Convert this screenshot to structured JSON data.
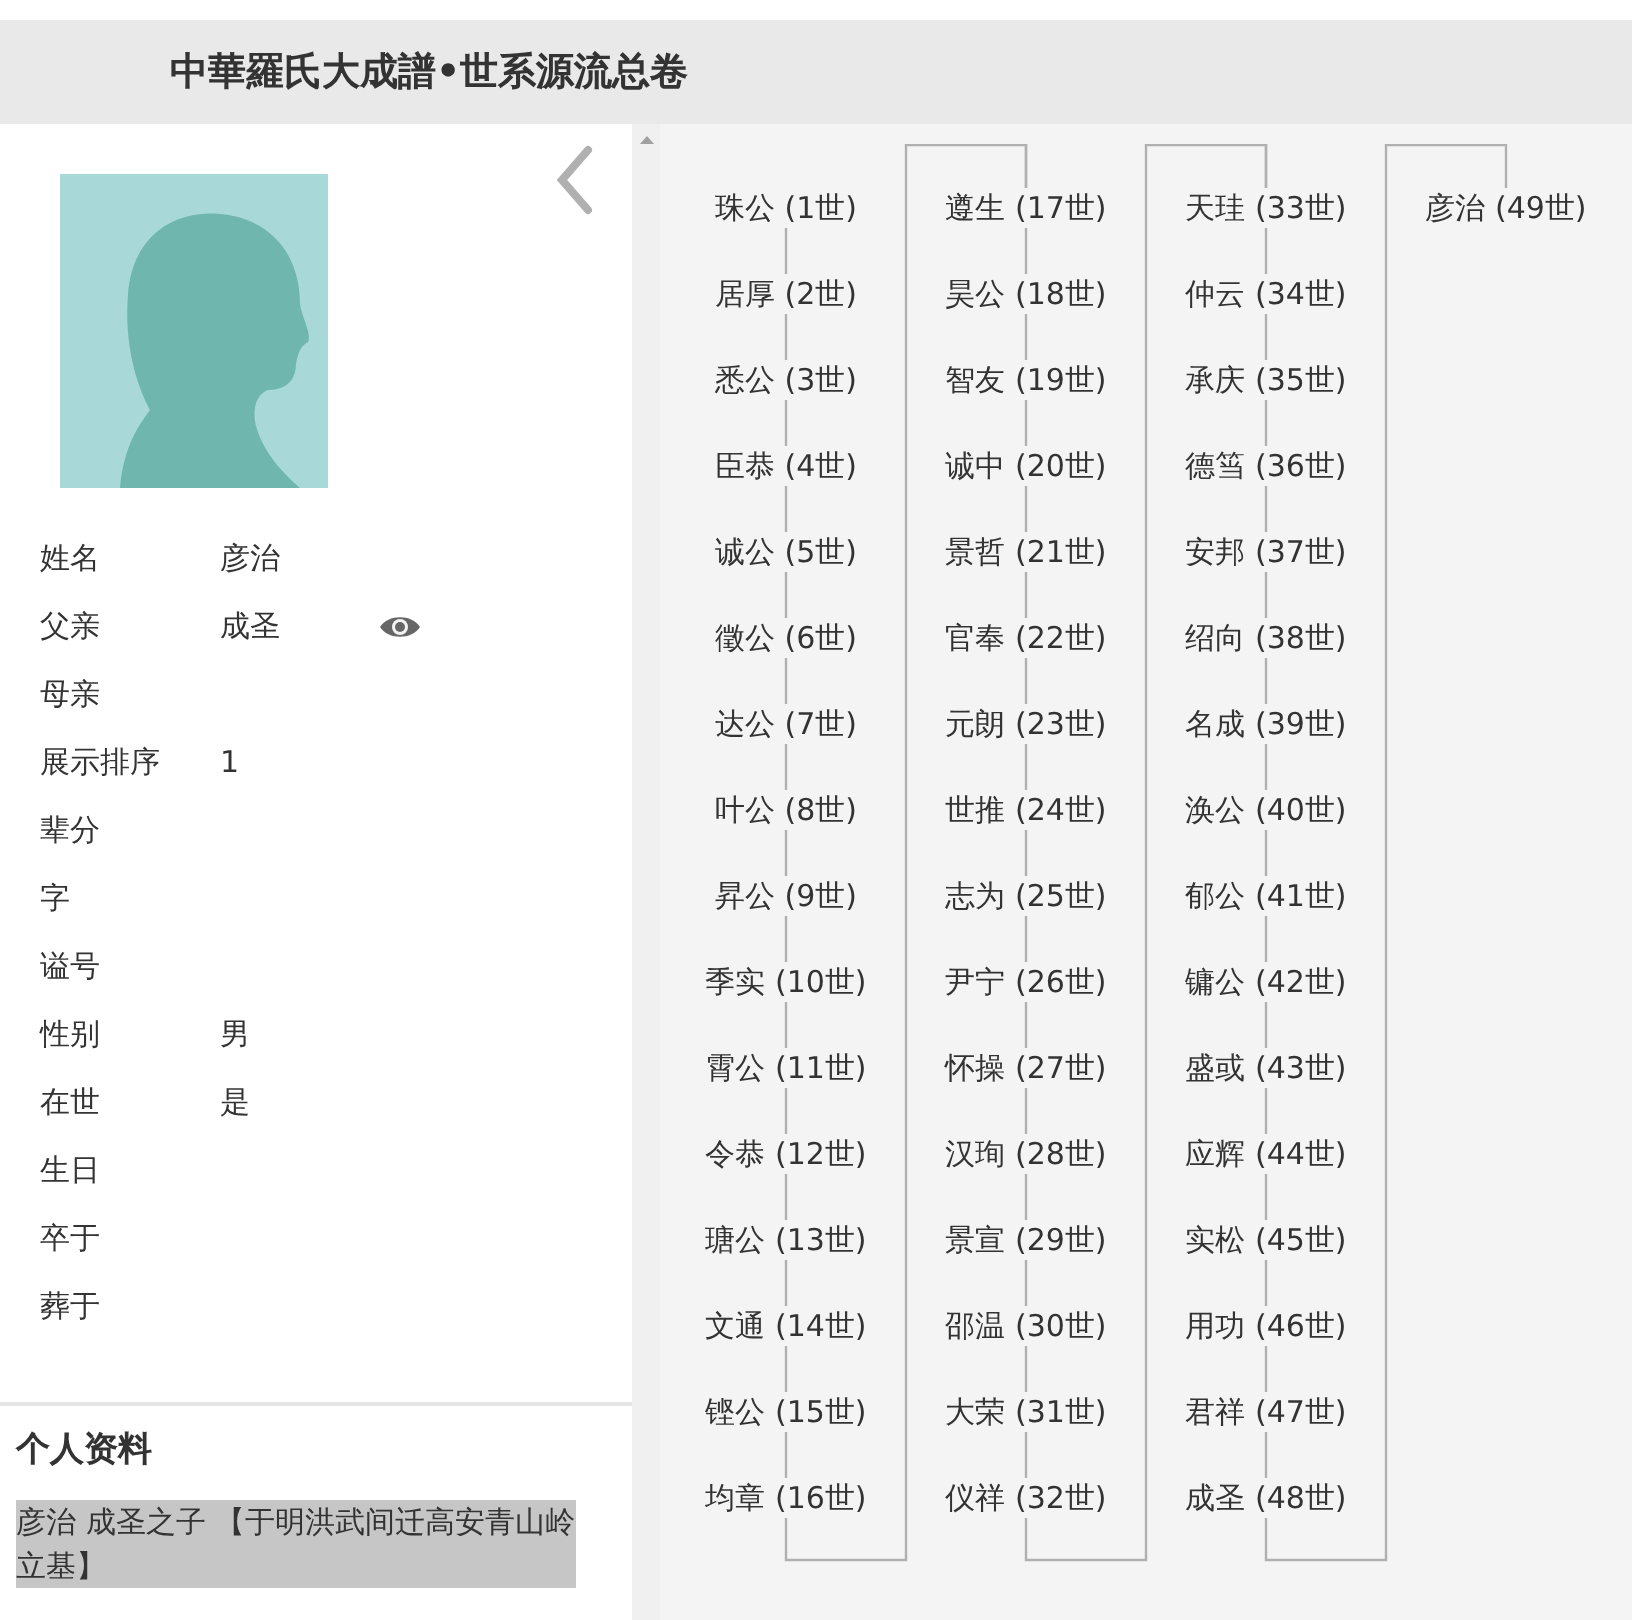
{
  "header": {
    "title": "中華羅氏大成譜•世系源流总卷"
  },
  "profile": {
    "fields": [
      {
        "label": "姓名",
        "value": "彦治"
      },
      {
        "label": "父亲",
        "value": "成圣",
        "viewable": true
      },
      {
        "label": "母亲"
      },
      {
        "label": "展示排序",
        "value": "1"
      },
      {
        "label": "辈分"
      },
      {
        "label": "字"
      },
      {
        "label": "谥号"
      },
      {
        "label": "性别",
        "value": "男"
      },
      {
        "label": "在世",
        "value": "是"
      },
      {
        "label": "生日"
      },
      {
        "label": "卒于"
      },
      {
        "label": "葬于"
      }
    ]
  },
  "personal_info": {
    "heading": "个人资料",
    "text": "彦治 成圣之子 【于明洪武间迁高安青山岭立基】"
  },
  "lineage": {
    "columns": [
      {
        "members": [
          "珠公 (1世)",
          "居厚 (2世)",
          "悉公 (3世)",
          "臣恭 (4世)",
          "诚公 (5世)",
          "徵公 (6世)",
          "达公 (7世)",
          "叶公 (8世)",
          "昇公 (9世)",
          "季实 (10世)",
          "霄公 (11世)",
          "令恭 (12世)",
          "瑭公 (13世)",
          "文通 (14世)",
          "铿公 (15世)",
          "均章 (16世)"
        ]
      },
      {
        "members": [
          "遵生 (17世)",
          "昊公 (18世)",
          "智友 (19世)",
          "诚中 (20世)",
          "景哲 (21世)",
          "官奉 (22世)",
          "元朗 (23世)",
          "世推 (24世)",
          "志为 (25世)",
          "尹宁 (26世)",
          "怀操 (27世)",
          "汉珣 (28世)",
          "景宣 (29世)",
          "邵温 (30世)",
          "大荣 (31世)",
          "仪祥 (32世)"
        ]
      },
      {
        "members": [
          "天珪 (33世)",
          "仲云 (34世)",
          "承庆 (35世)",
          "德筜 (36世)",
          "安邦 (37世)",
          "绍向 (38世)",
          "名成 (39世)",
          "涣公 (40世)",
          "郁公 (41世)",
          "镛公 (42世)",
          "盛或 (43世)",
          "应辉 (44世)",
          "实松 (45世)",
          "用功 (46世)",
          "君祥 (47世)",
          "成圣 (48世)"
        ]
      },
      {
        "members": [
          "彦治 (49世)"
        ]
      }
    ]
  }
}
